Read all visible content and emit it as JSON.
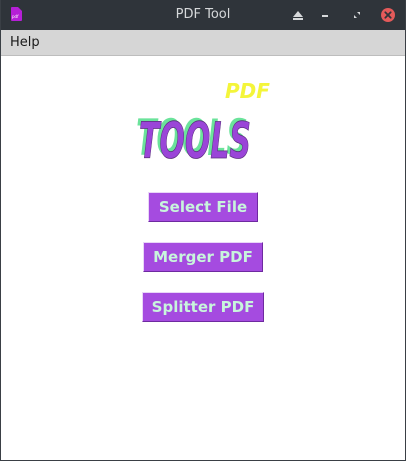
{
  "window": {
    "title": "PDF Tool",
    "app_icon_text": "pdf"
  },
  "menubar": {
    "items": [
      {
        "label": "Help"
      }
    ]
  },
  "logo": {
    "word": "TOOLS",
    "accent": "PDF"
  },
  "buttons": {
    "select_file": "Select File",
    "merger_pdf": "Merger PDF",
    "splitter_pdf": "Splitter PDF"
  },
  "colors": {
    "titlebar": "#2f343a",
    "button_bg": "#a54be0",
    "button_text": "#c8f5dc",
    "logo_purple": "#9a45d8",
    "logo_green": "#6be39b",
    "logo_yellow": "#f4f53a",
    "close_button": "#e45a5a"
  },
  "icons": {
    "app": "pdf-file-icon",
    "eject": "eject-icon",
    "minimize": "minimize-icon",
    "restore": "restore-icon",
    "close": "close-icon"
  }
}
